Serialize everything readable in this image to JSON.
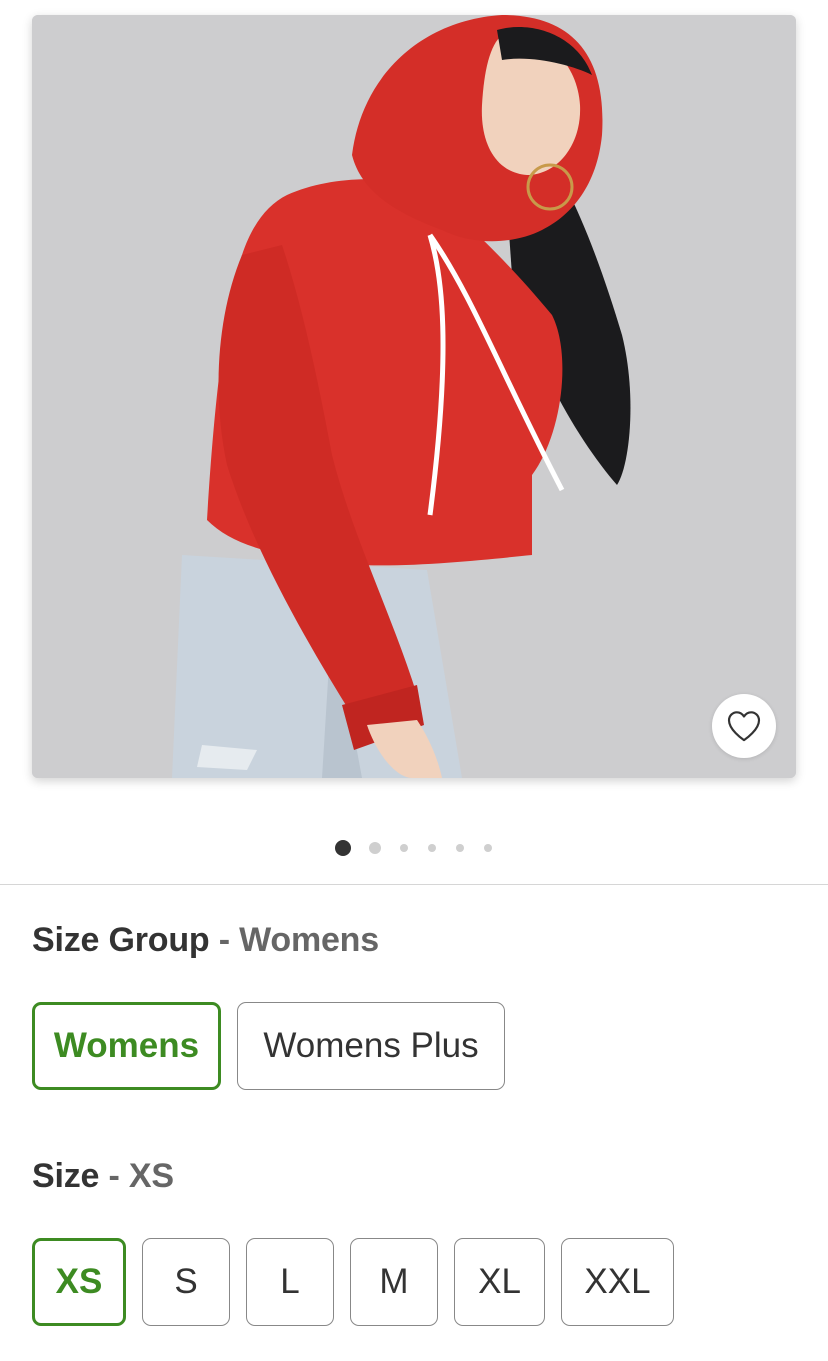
{
  "product_image": {
    "favorite_icon": "heart-outline-icon"
  },
  "carousel": {
    "total_images": 6,
    "active_index": 0
  },
  "size_group": {
    "label": "Size Group",
    "separator": "-",
    "selected": "Womens",
    "options": [
      "Womens",
      "Womens Plus"
    ]
  },
  "size": {
    "label": "Size",
    "separator": "-",
    "selected": "XS",
    "options": [
      "XS",
      "S",
      "L",
      "M",
      "XL",
      "XXL"
    ]
  },
  "colors": {
    "selected_accent": "#3d8b22",
    "text_primary": "#333333",
    "text_secondary": "#666666"
  }
}
